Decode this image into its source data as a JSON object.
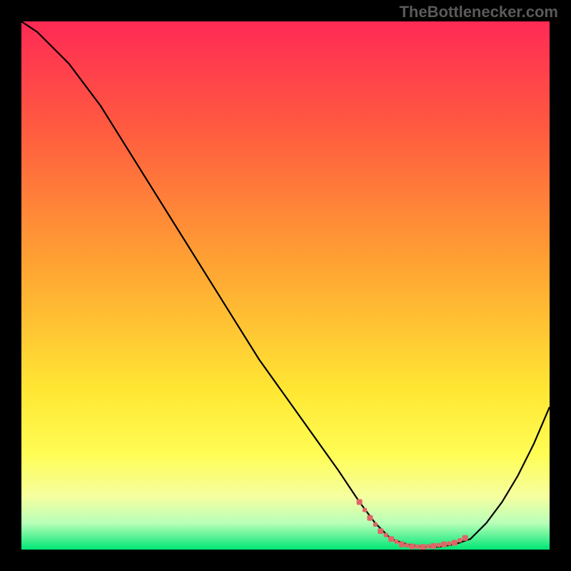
{
  "watermark": "TheBottlenecker.com",
  "colors": {
    "bg": "#000000",
    "watermark": "#5a5a5a",
    "curve": "#000000",
    "marker": "#e06666"
  },
  "chart_data": {
    "type": "line",
    "title": "",
    "xlabel": "",
    "ylabel": "",
    "xlim": [
      0,
      100
    ],
    "ylim": [
      0,
      100
    ],
    "gradient_stops": [
      {
        "offset": 0.0,
        "color": "#ff2a55"
      },
      {
        "offset": 0.2,
        "color": "#ff5a40"
      },
      {
        "offset": 0.45,
        "color": "#ffa033"
      },
      {
        "offset": 0.7,
        "color": "#ffe733"
      },
      {
        "offset": 0.82,
        "color": "#fffd55"
      },
      {
        "offset": 0.9,
        "color": "#f5ffa0"
      },
      {
        "offset": 0.95,
        "color": "#b8ffb8"
      },
      {
        "offset": 1.0,
        "color": "#00e676"
      }
    ],
    "series": [
      {
        "name": "bottleneck-curve",
        "x": [
          0,
          3,
          6,
          9,
          12,
          15,
          20,
          25,
          30,
          35,
          40,
          45,
          50,
          55,
          60,
          64,
          67,
          70,
          73,
          76,
          79,
          82,
          85,
          88,
          91,
          94,
          97,
          100
        ],
        "y": [
          100,
          98,
          95,
          92,
          88,
          84,
          76,
          68,
          60,
          52,
          44,
          36,
          29,
          22,
          15,
          9,
          5,
          2,
          1,
          0.5,
          0.5,
          1,
          2,
          5,
          9,
          14,
          20,
          27
        ]
      }
    ],
    "highlight": {
      "name": "optimal-range",
      "x": [
        64,
        66,
        68,
        70,
        72,
        74,
        76,
        78,
        80,
        82,
        84
      ],
      "y": [
        9,
        6,
        3.5,
        2,
        1,
        0.6,
        0.5,
        0.7,
        1,
        1.3,
        2.2
      ]
    }
  }
}
